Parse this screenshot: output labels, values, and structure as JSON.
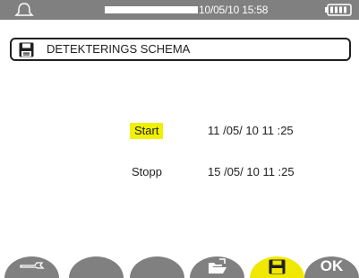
{
  "status_bar": {
    "icon": "bell-icon",
    "datetime": "10/05/10 15:58",
    "battery_icon": "battery-icon",
    "color": "#808080"
  },
  "title_bar": {
    "icon": "floppy-disk-icon",
    "title": "DETEKTERINGS SCHEMA"
  },
  "schedule": {
    "start_label": "Start",
    "start_value": "11 /05/ 10 11 :25",
    "stop_label": "Stopp",
    "stop_value": "15 /05/ 10 11 :25",
    "highlight_color": "#f0f000"
  },
  "softkeys": [
    {
      "icon": "wrench-icon",
      "active": false
    },
    {
      "icon": "",
      "active": false
    },
    {
      "icon": "",
      "active": false
    },
    {
      "icon": "open-folder-icon",
      "active": false
    },
    {
      "icon": "floppy-disk-icon",
      "active": true
    },
    {
      "label": "OK",
      "active": false
    }
  ]
}
